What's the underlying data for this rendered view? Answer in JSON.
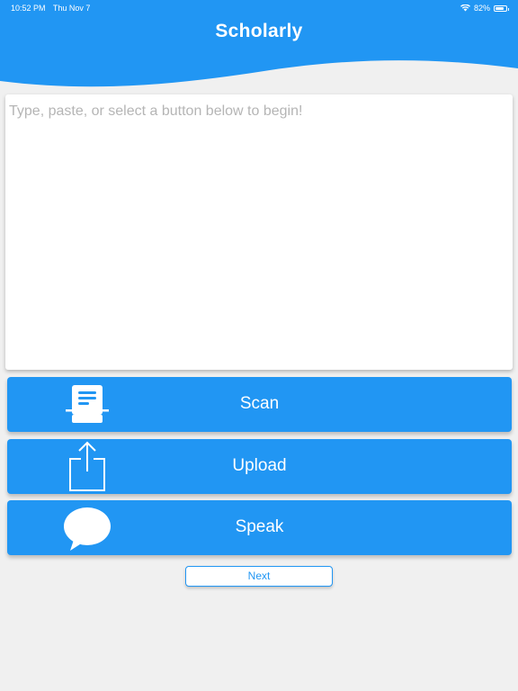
{
  "status_bar": {
    "time": "10:52 PM",
    "date": "Thu Nov 7",
    "battery_text": "82%",
    "battery_level": 0.82,
    "wifi_icon": "wifi-icon",
    "battery_icon": "battery-icon"
  },
  "header": {
    "title": "Scholarly",
    "color": "#2196f3"
  },
  "editor": {
    "placeholder": "Type, paste, or select a button below to begin!",
    "value": ""
  },
  "actions": [
    {
      "label": "Scan",
      "icon": "scanner-icon"
    },
    {
      "label": "Upload",
      "icon": "upload-icon"
    },
    {
      "label": "Speak",
      "icon": "speech-bubble-icon"
    }
  ],
  "next_label": "Next",
  "colors": {
    "accent": "#2196f3",
    "background": "#f0f0f0"
  }
}
